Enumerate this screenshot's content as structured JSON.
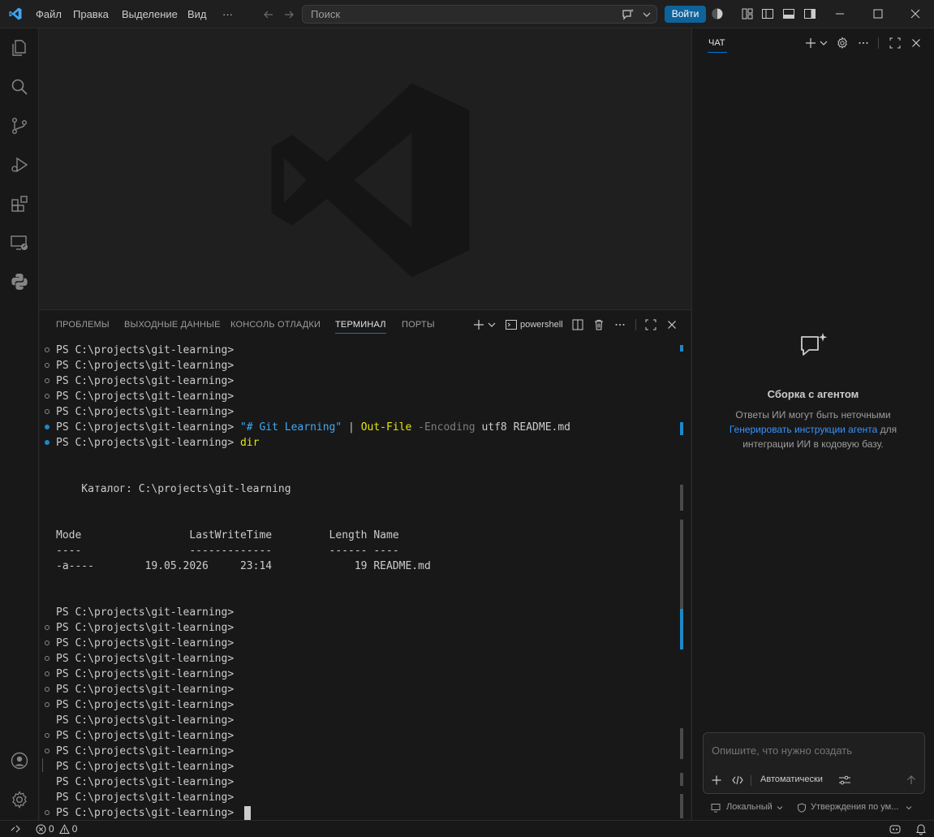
{
  "titlebar": {
    "menu": [
      "Файл",
      "Правка",
      "Выделение",
      "Вид",
      "···"
    ],
    "search_placeholder": "Поиск",
    "login_label": "Войти"
  },
  "activitybar": {
    "items": [
      "explorer-icon",
      "search-icon",
      "source-control-icon",
      "run-debug-icon",
      "extensions-icon",
      "remote-explorer-icon",
      "python-icon"
    ],
    "bottom": [
      "account-icon",
      "manage-gear-icon"
    ]
  },
  "panel": {
    "tabs": [
      "ПРОБЛЕМЫ",
      "ВЫХОДНЫЕ ДАННЫЕ",
      "КОНСОЛЬ ОТЛАДКИ",
      "ТЕРМИНАЛ",
      "ПОРТЫ"
    ],
    "active_tab": "ТЕРМИНАЛ",
    "shell_name": "powershell"
  },
  "terminal": {
    "prompt": "PS C:\\projects\\git-learning>",
    "cmd1": {
      "string": "\"# Git Learning\"",
      "pipe": "|",
      "cmdlet": "Out-File",
      "param": "-Encoding",
      "rest": "utf8 README.md"
    },
    "cmd2": "dir",
    "catalog": "    Каталог: C:\\projects\\git-learning",
    "table_header": "Mode                 LastWriteTime         Length Name",
    "table_sep": "----                 -------------         ------ ----",
    "table_row": "-a----        19.05.2026     23:14             19 README.md"
  },
  "chat": {
    "tab_label": "ЧАТ",
    "title": "Сборка с агентом",
    "desc_line1": "Ответы ИИ могут быть неточными",
    "desc_link": "Генерировать инструкции агента",
    "desc_after_link": " для",
    "desc_line3": "интеграции ИИ в кодовую базу.",
    "input_placeholder": "Опишите, что нужно создать",
    "mode_label": "Автоматически",
    "footer_local": "Локальный",
    "footer_approvals": "Утверждения по ум..."
  },
  "statusbar": {
    "errors": "0",
    "warnings": "0"
  },
  "colors": {
    "accent": "#0078d4",
    "button": "#0e639c",
    "link": "#3794ff",
    "terminal_string": "#3fa9f5",
    "terminal_cmdlet": "#e5e510",
    "success_decoration": "#1e88c8"
  }
}
